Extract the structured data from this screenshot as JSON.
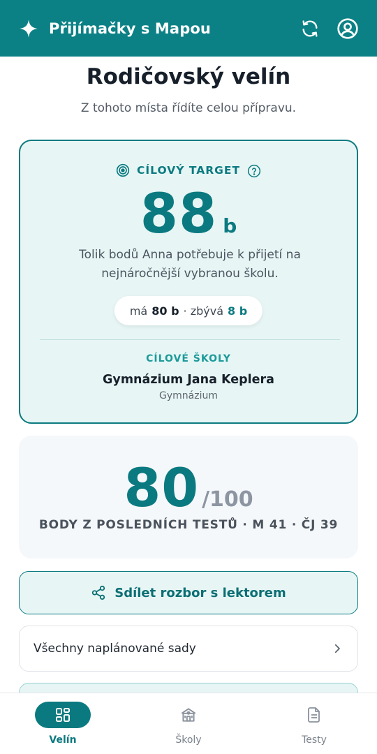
{
  "app": {
    "title": "Přijímačky s Mapou",
    "logo_icon": "sparkle-icon",
    "actions": [
      {
        "name": "refresh",
        "icon": "refresh-icon"
      },
      {
        "name": "profile",
        "icon": "user-circle-icon"
      }
    ],
    "brand_color": "#0b8186"
  },
  "page": {
    "title": "Rodičovský velín",
    "subtitle": "Z tohoto místa řídíte celou přípravu."
  },
  "target": {
    "label": "CÍLOVÝ TARGET",
    "points": "88",
    "unit": "b",
    "description": "Tolik bodů Anna potřebuje k přijetí na nejnáročnější vybranou školu.",
    "status": {
      "has_prefix": "má",
      "has_value": "80 b",
      "remaining_prefix": "· zbývá",
      "remaining_value": "8 b"
    },
    "schools_label": "CÍLOVÉ ŠKOLY",
    "school_name": "Gymnázium Jana Keplera",
    "school_type": "Gymnázium"
  },
  "score": {
    "value": "80",
    "max": "/100",
    "caption": "BODY Z POSLEDNÍCH TESTŮ · M 41 · ČJ 39"
  },
  "share": {
    "label": "Sdílet rozbor s lektorem",
    "icon": "share-icon"
  },
  "sets_row": {
    "label": "Všechny naplánované sady",
    "icon": "chevron-right-icon"
  },
  "nav": {
    "items": [
      {
        "label": "Velín",
        "icon": "dashboard-icon",
        "active": true
      },
      {
        "label": "Školy",
        "icon": "school-icon",
        "active": false
      },
      {
        "label": "Testy",
        "icon": "document-icon",
        "active": false
      }
    ]
  }
}
